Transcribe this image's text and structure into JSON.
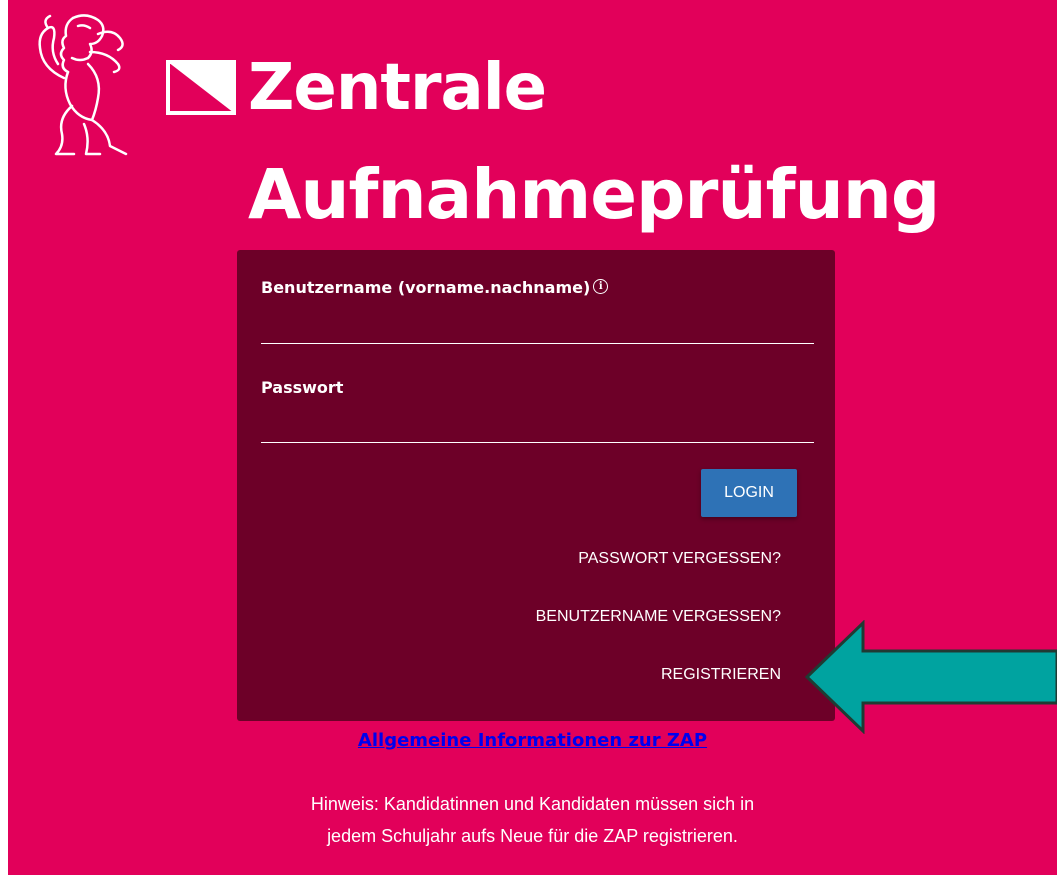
{
  "header": {
    "title_line_1": "Zentrale",
    "title_line_2": "Aufnahmeprüfung",
    "logo_icon": "zurich-lion-icon",
    "flag_icon": "zurich-flag-icon"
  },
  "login_form": {
    "username_label": "Benutzername (vorname.nachname)",
    "username_value": "",
    "info_icon": "info-icon",
    "password_label": "Passwort",
    "password_value": "",
    "login_button": "LOGIN",
    "forgot_password": "PASSWORT VERGESSEN?",
    "forgot_username": "BENUTZERNAME VERGESSEN?",
    "register": "REGISTRIEREN"
  },
  "info_link": "Allgemeine Informationen zur ZAP",
  "hint": {
    "line_1": "Hinweis: Kandidatinnen und Kandidaten müssen sich in",
    "line_2": "jedem Schuljahr aufs Neue für die ZAP registrieren."
  },
  "colors": {
    "background": "#e2005a",
    "panel": "#6d0028",
    "button": "#2e72b6",
    "arrow": "#00a3a0",
    "link": "#0000ee"
  }
}
